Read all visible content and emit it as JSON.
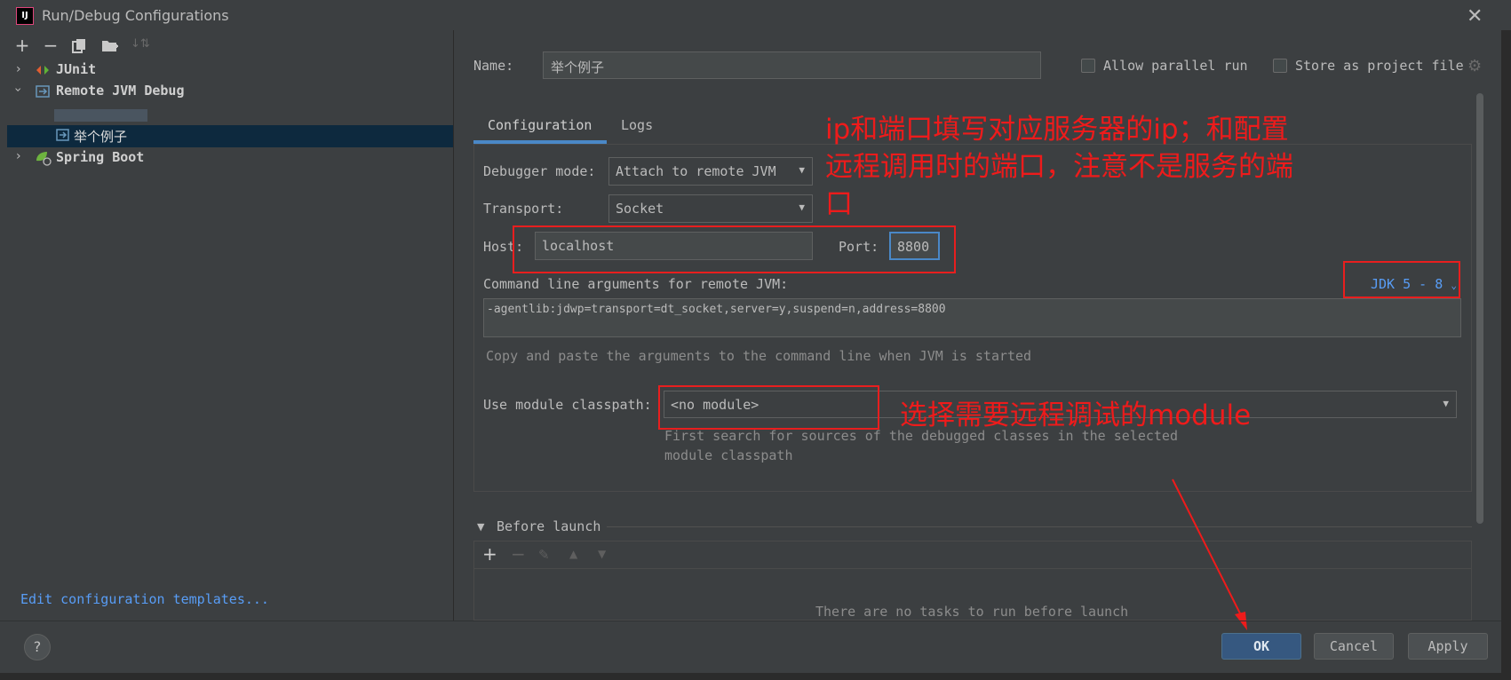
{
  "window": {
    "title": "Run/Debug Configurations"
  },
  "left": {
    "tree": [
      {
        "label": "JUnit"
      },
      {
        "label": "Remote JVM Debug"
      },
      {
        "label": "举个例子"
      },
      {
        "label": "Spring Boot"
      }
    ],
    "templates_link": "Edit configuration templates..."
  },
  "form": {
    "name_label": "Name:",
    "name_value": "举个例子",
    "allow_parallel": "Allow parallel run",
    "store_project": "Store as project file",
    "tabs": [
      "Configuration",
      "Logs"
    ],
    "debugger_mode_label": "Debugger mode:",
    "debugger_mode_value": "Attach to remote JVM",
    "transport_label": "Transport:",
    "transport_value": "Socket",
    "host_label": "Host:",
    "host_value": "localhost",
    "port_label": "Port:",
    "port_value": "8800",
    "cmdline_label": "Command line arguments for remote JVM:",
    "jdk_value": "JDK 5 - 8",
    "cmdline_value": "-agentlib:jdwp=transport=dt_socket,server=y,suspend=n,address=8800",
    "cmdline_hint": "Copy and paste the arguments to the command line when JVM is started",
    "module_label": "Use module classpath:",
    "module_value": "<no module>",
    "module_hint_1": "First search for sources of the debugged classes in the selected",
    "module_hint_2": "module classpath",
    "before_launch": "Before launch",
    "no_tasks": "There are no tasks to run before launch"
  },
  "annotations": {
    "note1_line1": "ip和端口填写对应服务器的ip；和配置",
    "note1_line2": "远程调用时的端口，注意不是服务的端",
    "note1_line3": "口",
    "note2": "选择需要远程调试的module"
  },
  "buttons": {
    "ok": "OK",
    "cancel": "Cancel",
    "apply": "Apply",
    "help": "?"
  }
}
